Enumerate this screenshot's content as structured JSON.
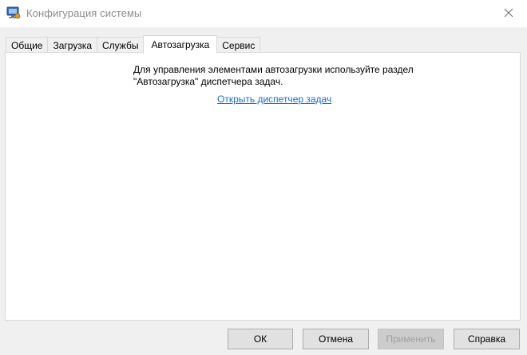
{
  "window": {
    "title": "Конфигурация системы",
    "icon": "system-config-icon"
  },
  "tabs": [
    {
      "label": "Общие",
      "active": false
    },
    {
      "label": "Загрузка",
      "active": false
    },
    {
      "label": "Службы",
      "active": false
    },
    {
      "label": "Автозагрузка",
      "active": true
    },
    {
      "label": "Сервис",
      "active": false
    }
  ],
  "startup": {
    "info_line1": "Для управления элементами автозагрузки используйте раздел",
    "info_line2": "\"Автозагрузка\" диспетчера задач.",
    "link": "Открыть диспетчер задач"
  },
  "buttons": {
    "ok": "ОК",
    "cancel": "Отмена",
    "apply": "Применить",
    "help": "Справка"
  },
  "colors": {
    "link": "#1a6bd1",
    "disabled_text": "#a0a0a0",
    "window_bg": "#f0f0f0"
  }
}
